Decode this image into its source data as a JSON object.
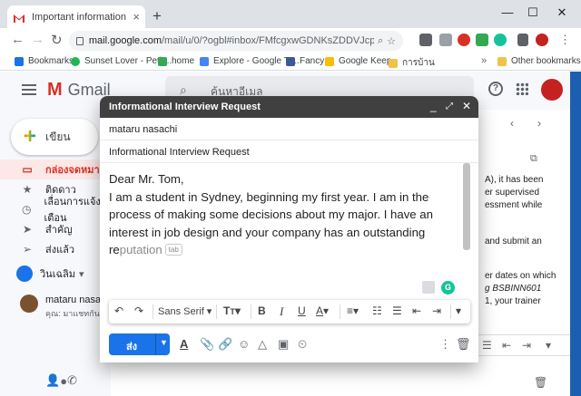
{
  "browser": {
    "tab_title": "Important information about yo",
    "new_tab": "+",
    "url_host": "mail.google.com",
    "url_path": "/mail/u/0/?ogbl#inbox/FMfcgxwGDNKsZDDVJcpgHFbDKBfdlz..."
  },
  "bookmarks": [
    {
      "label": "Bookmarks",
      "color": "#1a73e8"
    },
    {
      "label": "Sunset Lover - Petit...",
      "color": "#1db954"
    },
    {
      "label": "home",
      "color": "#34a853"
    },
    {
      "label": "Explore - Google Tr...",
      "color": "#4285f4"
    },
    {
      "label": "Fancy",
      "color": "#3b5998"
    },
    {
      "label": "Google Keep",
      "color": "#fbbc04"
    },
    {
      "label": "การบ้าน",
      "color": "#f0c24a"
    },
    {
      "label": "Other bookmarks",
      "color": "#f0c24a"
    }
  ],
  "gmail": {
    "logo": "Gmail",
    "search_placeholder": "ค้นหาอีเมล",
    "compose_label": "เขียน",
    "sidebar": [
      {
        "label": "กล่องจดหมาย",
        "icon": "inbox-icon",
        "glyph": "▭"
      },
      {
        "label": "ติดดาว",
        "icon": "star-icon",
        "glyph": "★"
      },
      {
        "label": "เลื่อนการแจ้งเตือน",
        "icon": "clock-icon",
        "glyph": "◷"
      },
      {
        "label": "สำคัญ",
        "icon": "important-icon",
        "glyph": "➤"
      },
      {
        "label": "ส่งแล้ว",
        "icon": "send-icon",
        "glyph": "➢"
      }
    ],
    "hangouts_user": "วินเฉลิม",
    "chat_name": "mataru nasachi",
    "chat_preview": "คุณ: มาแชทกันใน Ha",
    "snippets": [
      "A), it has been",
      "er supervised",
      "essment while",
      "and submit an",
      "er dates on which",
      "g BSBINN601",
      "1, your trainer"
    ]
  },
  "compose": {
    "title": "Informational Interview Request",
    "to": "mataru nasachi",
    "subject": "Informational Interview Request",
    "body_line1": "Dear Mr. Tom,",
    "body_main": "I am a student in Sydney, beginning my first year. I am in the process of making some decisions about my major. I have an interest in job design and your company has an outstanding re",
    "body_suggestion": "putation",
    "tab_hint": "tab",
    "font": "Sans Serif",
    "send_label": "ส่ง",
    "grammarly": "G"
  },
  "colors": {
    "accent": "#1a73e8",
    "gmail_red": "#d93025",
    "compose_header": "#404040"
  }
}
